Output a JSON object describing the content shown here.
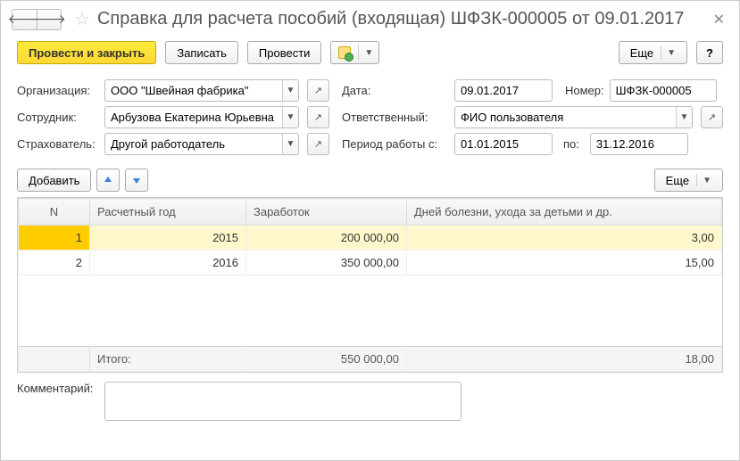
{
  "title": "Справка для расчета пособий (входящая) ШФЗК-000005 от 09.01.2017",
  "toolbar": {
    "post_close": "Провести и закрыть",
    "write": "Записать",
    "post": "Провести",
    "more": "Еще",
    "help": "?"
  },
  "fields": {
    "org_label": "Организация:",
    "org_value": "ООО \"Швейная фабрика\"",
    "date_label": "Дата:",
    "date_value": "09.01.2017",
    "number_label": "Номер:",
    "number_value": "ШФЗК-000005",
    "employee_label": "Сотрудник:",
    "employee_value": "Арбузова Екатерина Юрьевна",
    "responsible_label": "Ответственный:",
    "responsible_value": "ФИО пользователя",
    "insurer_label": "Страхователь:",
    "insurer_value": "Другой работодатель",
    "period_label": "Период работы с:",
    "period_from": "01.01.2015",
    "period_to_label": "по:",
    "period_to": "31.12.2016"
  },
  "table": {
    "add": "Добавить",
    "more": "Еще",
    "headers": {
      "n": "N",
      "year": "Расчетный год",
      "earn": "Заработок",
      "days": "Дней болезни, ухода за детьми и др."
    },
    "rows": [
      {
        "n": "1",
        "year": "2015",
        "earn": "200 000,00",
        "days": "3,00"
      },
      {
        "n": "2",
        "year": "2016",
        "earn": "350 000,00",
        "days": "15,00"
      }
    ],
    "footer": {
      "label": "Итого:",
      "earn": "550 000,00",
      "days": "18,00"
    }
  },
  "comment_label": "Комментарий:"
}
